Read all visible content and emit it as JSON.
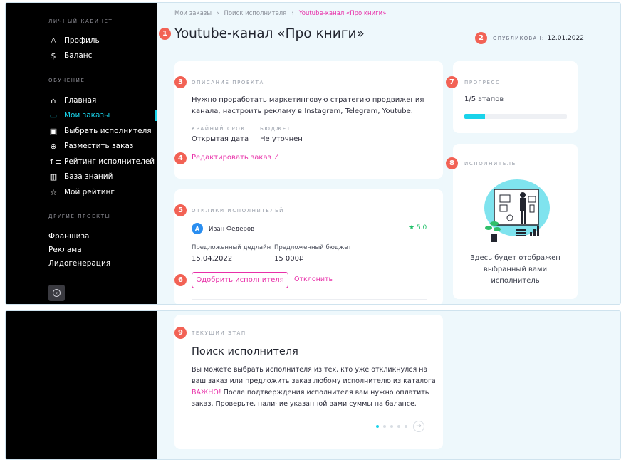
{
  "sidebar": {
    "section_personal": "ЛИЧНЫЙ КАБИНЕТ",
    "profile": "Профиль",
    "balance": "Баланс",
    "section_learning": "ОБУЧЕНИЕ",
    "nav": [
      {
        "label": "Главная",
        "icon": "home-icon"
      },
      {
        "label": "Мои заказы",
        "icon": "orders-icon"
      },
      {
        "label": "Выбрать исполнителя",
        "icon": "choose-performer-icon"
      },
      {
        "label": "Разместить заказ",
        "icon": "plus-circle-icon"
      },
      {
        "label": "Рейтинг исполнителей",
        "icon": "sort-icon"
      },
      {
        "label": "База знаний",
        "icon": "library-icon"
      },
      {
        "label": "Мой рейтинг",
        "icon": "star-icon"
      }
    ],
    "section_other": "ДРУГИЕ ПРОЕКТЫ",
    "other": [
      "Франшиза",
      "Реклама",
      "Лидогенерация"
    ]
  },
  "breadcrumb": [
    "Мои заказы",
    "Поиск исполнителя",
    "Youtube-канал «Про книги»"
  ],
  "title": "Youtube-канал «Про книги»",
  "published": {
    "label": "ОПУБЛИКОВАН:",
    "date": "12.01.2022"
  },
  "markers": [
    "1",
    "2",
    "3",
    "4",
    "5",
    "6",
    "7",
    "8",
    "9"
  ],
  "description": {
    "label": "ОПИСАНИЕ ПРОЕКТА",
    "text": "Нужно проработать маркетинговую стратегию продвижения канала, настроить рекламу в Instagram, Telegram, Youtube.",
    "deadline_label": "КРАЙНИЙ СРОК",
    "deadline_value": "Открытая дата",
    "budget_label": "БЮДЖЕТ",
    "budget_value": "Не уточнен",
    "edit_link": "Редактировать заказ"
  },
  "responses": {
    "label": "ОТКЛИКИ ИСПОЛНИТЕЛЕЙ",
    "avatar_letter": "А",
    "name": "Иван Фёдеров",
    "rating": "5.0",
    "deadline_label": "Предложенный дедлайн",
    "deadline_value": "15.04.2022",
    "budget_label": "Предложенный бюджет",
    "budget_value": "15 000₽",
    "approve": "Одобрить исполнителя",
    "decline": "Отклонить"
  },
  "progress": {
    "label": "ПРОГРЕСС",
    "done": "1",
    "total": "/5",
    "unit": "этапов",
    "fraction": 0.2
  },
  "performer": {
    "label": "ИСПОЛНИТЕЛЬ",
    "placeholder": "Здесь будет отображен выбранный вами исполнитель"
  },
  "stage": {
    "label": "ТЕКУЩИЙ ЭТАП",
    "title": "Поиск исполнителя",
    "text": "Вы можете выбрать исполнителя из тех, кто уже откликнулся на ваш заказ или предложить заказ любому исполнителю из каталога",
    "important_label": "ВАЖНО!",
    "important_text": " После подтверждения исполнителя вам нужно оплатить заказ. Проверьте, наличие указанной вами суммы на балансе.",
    "pages": 5,
    "current_page": 1
  },
  "colors": {
    "accent": "#19d3ea",
    "link": "#e82fa8",
    "marker": "#f26255",
    "sidebar": "#000000"
  }
}
